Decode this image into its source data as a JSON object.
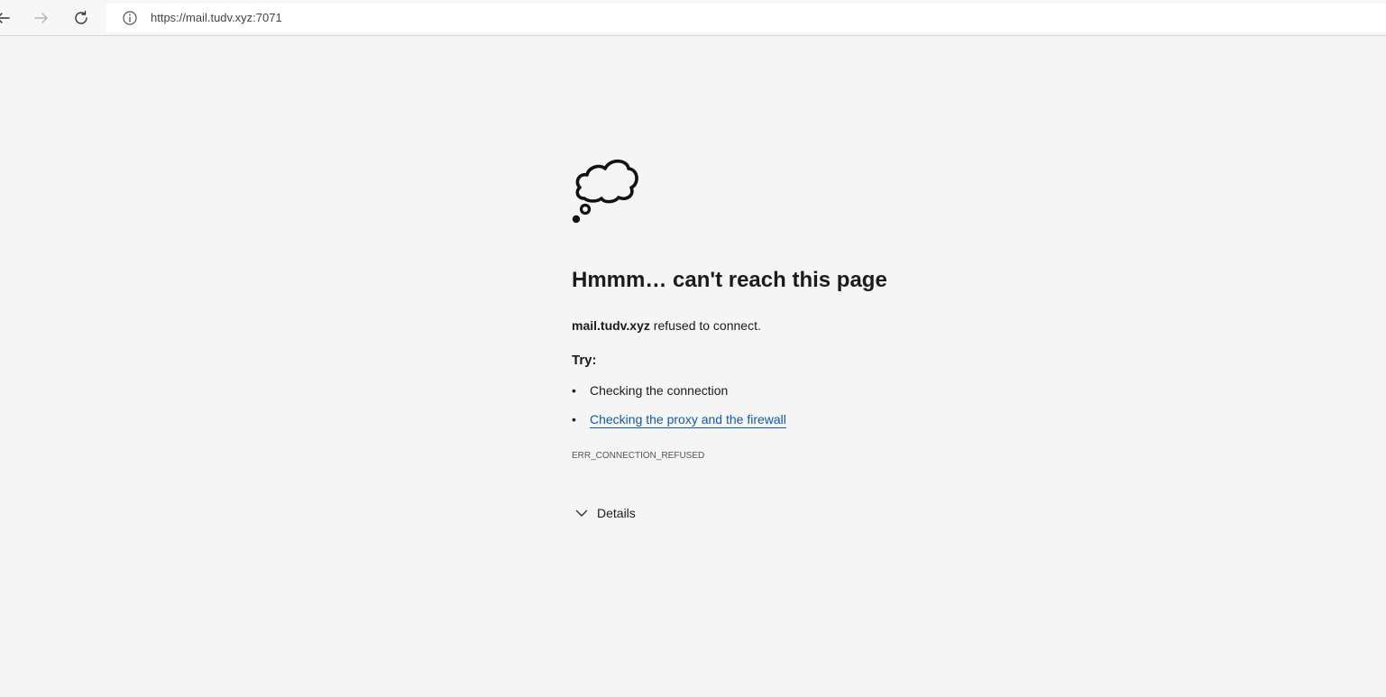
{
  "browser": {
    "back_icon": "arrow-left-icon",
    "forward_icon": "arrow-right-icon",
    "refresh_icon": "refresh-icon",
    "site_info_icon": "info-circle-icon",
    "url": "https://mail.tudv.xyz:7071"
  },
  "error_page": {
    "illustration_icon": "thought-cloud-icon",
    "heading": "Hmmm… can't reach this page",
    "host": "mail.tudv.xyz",
    "message": " refused to connect.",
    "try_label": "Try:",
    "bullet": "•",
    "suggestions": [
      "Checking the connection",
      "Checking the proxy and the firewall"
    ],
    "error_code": "ERR_CONNECTION_REFUSED",
    "details_label": "Details",
    "details_icon": "chevron-down-icon",
    "link_color": "#0e5aa7"
  }
}
